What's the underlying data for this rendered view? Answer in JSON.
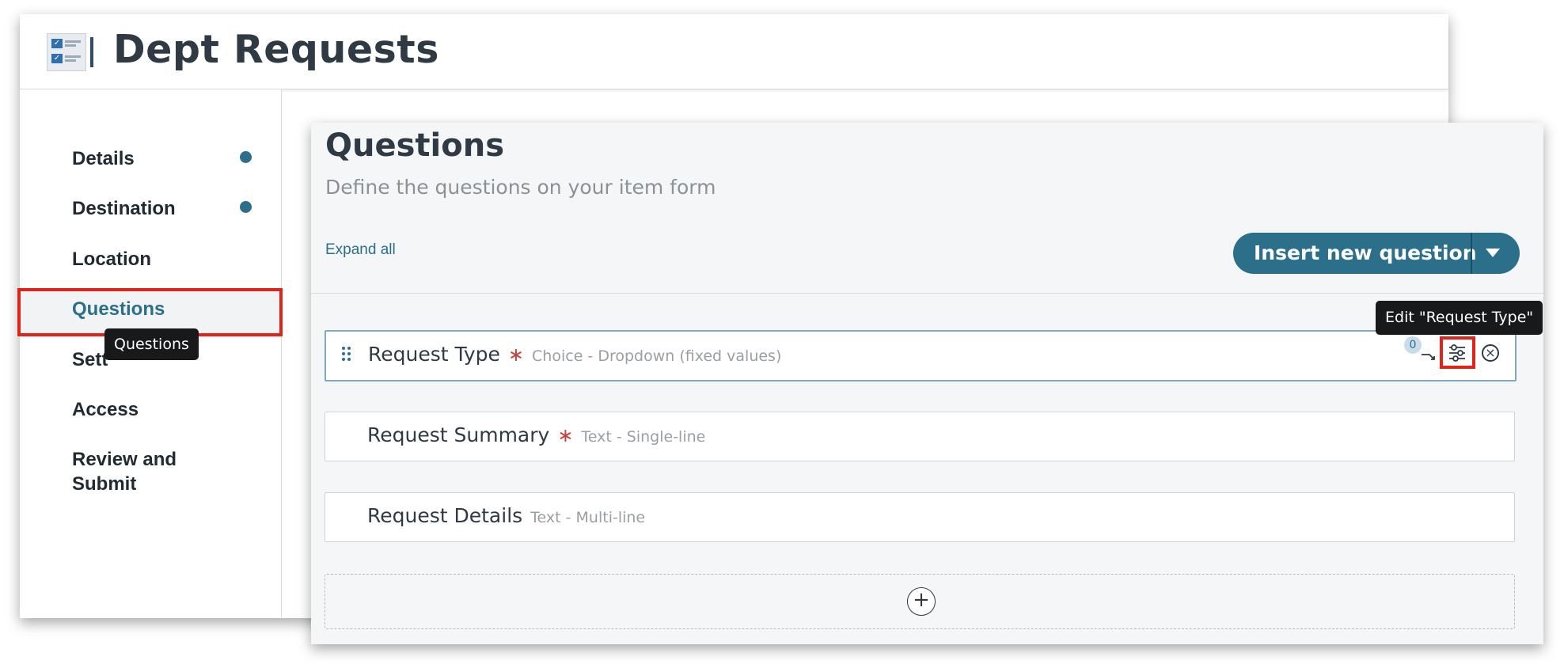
{
  "app": {
    "title": "Dept Requests",
    "logo_icon": "checklist-form-icon"
  },
  "sidebar": {
    "items": [
      {
        "label": "Details",
        "complete": true
      },
      {
        "label": "Destination",
        "complete": true
      },
      {
        "label": "Location",
        "complete": false
      },
      {
        "label": "Questions",
        "active": true
      },
      {
        "label": "Sett",
        "complete": false
      },
      {
        "label": "Access",
        "complete": false
      },
      {
        "label": "Review and Submit",
        "complete": false
      }
    ],
    "tooltip": "Questions",
    "complete_dot_color": "#2b6f8a",
    "active_color": "#2b6f8a"
  },
  "panel": {
    "title": "Questions",
    "subtitle": "Define the questions on your item form",
    "expand_all": "Expand all",
    "insert_button": "Insert new question",
    "questions": [
      {
        "name": "Request Type",
        "required": "∗",
        "type": "Choice - Dropdown (fixed values)",
        "branch_count": "0"
      },
      {
        "name": "Request Summary",
        "required": "∗",
        "type": "Text - Single-line"
      },
      {
        "name": "Request Details",
        "required": "",
        "type": "Text - Multi-line"
      }
    ],
    "edit_tooltip": "Edit \"Request Type\"",
    "add_icon": "plus-circle-icon"
  },
  "colors": {
    "accent": "#2b6f8a",
    "highlight": "#e2231a",
    "required": "#c9423b"
  }
}
